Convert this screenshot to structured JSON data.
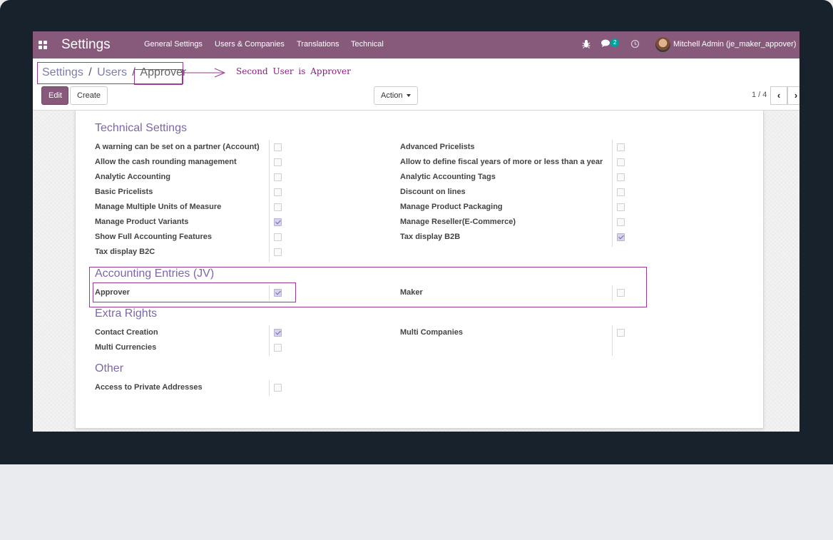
{
  "navbar": {
    "brand": "Settings",
    "menu": [
      "General Settings",
      "Users & Companies",
      "Translations",
      "Technical"
    ],
    "messages_count": "2",
    "user_name": "Mitchell Admin (je_maker_appover)"
  },
  "breadcrumb": {
    "root": "Settings",
    "middle": "Users",
    "current": "Approver",
    "sep": "/"
  },
  "annotation": {
    "text": "Second User is Approver"
  },
  "toolbar": {
    "edit_label": "Edit",
    "create_label": "Create",
    "action_label": "Action",
    "pager": "1 / 4"
  },
  "sections": {
    "technical": {
      "title": "Technical Settings",
      "left": [
        {
          "label": "A warning can be set on a partner (Account)",
          "checked": false
        },
        {
          "label": "Allow the cash rounding management",
          "checked": false
        },
        {
          "label": "Analytic Accounting",
          "checked": false
        },
        {
          "label": "Basic Pricelists",
          "checked": false
        },
        {
          "label": "Manage Multiple Units of Measure",
          "checked": false
        },
        {
          "label": "Manage Product Variants",
          "checked": true
        },
        {
          "label": "Show Full Accounting Features",
          "checked": false
        },
        {
          "label": "Tax display B2C",
          "checked": false
        }
      ],
      "right": [
        {
          "label": "Advanced Pricelists",
          "checked": false
        },
        {
          "label": "Allow to define fiscal years of more or less than a year",
          "checked": false
        },
        {
          "label": "Analytic Accounting Tags",
          "checked": false
        },
        {
          "label": "Discount on lines",
          "checked": false
        },
        {
          "label": "Manage Product Packaging",
          "checked": false
        },
        {
          "label": "Manage Reseller(E-Commerce)",
          "checked": false
        },
        {
          "label": "Tax display B2B",
          "checked": true
        }
      ]
    },
    "accounting": {
      "title": "Accounting Entries (JV)",
      "left": [
        {
          "label": "Approver",
          "checked": true
        }
      ],
      "right": [
        {
          "label": "Maker",
          "checked": false
        }
      ]
    },
    "extra": {
      "title": "Extra Rights",
      "left": [
        {
          "label": "Contact Creation",
          "checked": true
        },
        {
          "label": "Multi Currencies",
          "checked": false
        }
      ],
      "right": [
        {
          "label": "Multi Companies",
          "checked": false
        }
      ]
    },
    "other": {
      "title": "Other",
      "left": [
        {
          "label": "Access to Private Addresses",
          "checked": false
        }
      ]
    }
  },
  "colors": {
    "navbar": "#875a7b",
    "accent": "#7c7bad",
    "annotation": "#9b3b95"
  }
}
